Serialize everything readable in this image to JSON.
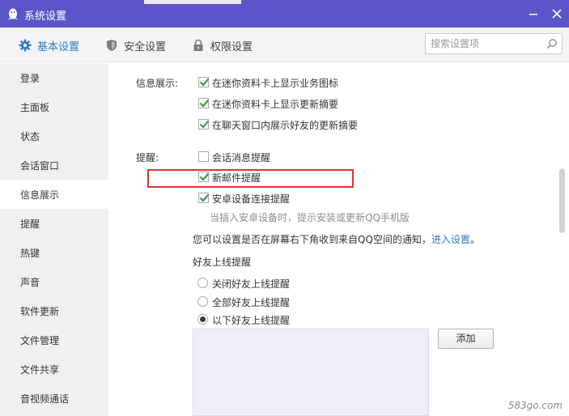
{
  "window": {
    "title": "系统设置",
    "minimize_symbol": "minimize-icon",
    "close_symbol": "close-icon"
  },
  "tabs": [
    {
      "label": "基本设置",
      "icon": "gear-icon",
      "active": true
    },
    {
      "label": "安全设置",
      "icon": "shield-icon",
      "active": false
    },
    {
      "label": "权限设置",
      "icon": "lock-icon",
      "active": false
    }
  ],
  "search": {
    "placeholder": "搜索设置项",
    "value": ""
  },
  "sidebar": {
    "items": [
      {
        "label": "登录"
      },
      {
        "label": "主面板"
      },
      {
        "label": "状态"
      },
      {
        "label": "会话窗口"
      },
      {
        "label": "信息展示",
        "active": true
      },
      {
        "label": "提醒"
      },
      {
        "label": "热键"
      },
      {
        "label": "声音"
      },
      {
        "label": "软件更新"
      },
      {
        "label": "文件管理"
      },
      {
        "label": "文件共享"
      },
      {
        "label": "音视频通话"
      }
    ]
  },
  "info_display": {
    "label": "信息展示:",
    "options": [
      {
        "label": "在迷你资料卡上显示业务图标",
        "checked": true
      },
      {
        "label": "在迷你资料卡上显示更新摘要",
        "checked": true
      },
      {
        "label": "在聊天窗口内展示好友的更新摘要",
        "checked": true
      }
    ]
  },
  "reminder": {
    "label": "提醒:",
    "options": [
      {
        "label": "会话消息提醒",
        "checked": false
      },
      {
        "label": "新邮件提醒",
        "checked": true
      },
      {
        "label": "安卓设备连接提醒",
        "checked": true
      }
    ],
    "android_hint": "当插入安卓设备时，提示安装或更新QQ手机版",
    "qzone_text": "您可以设置是否在屏幕右下角收到来自QQ空间的通知，",
    "qzone_link": "进入设置",
    "qzone_end": "。"
  },
  "friend_online": {
    "title": "好友上线提醒",
    "options": [
      {
        "label": "关闭好友上线提醒",
        "selected": false
      },
      {
        "label": "全部好友上线提醒",
        "selected": false
      },
      {
        "label": "以下好友上线提醒",
        "selected": true
      }
    ],
    "add_button": "添加"
  },
  "watermark": "583go.com",
  "colors": {
    "titlebar": "#5b55c9",
    "accent": "#2f79c8",
    "check": "#3e9b4e",
    "highlight": "#e03333"
  }
}
